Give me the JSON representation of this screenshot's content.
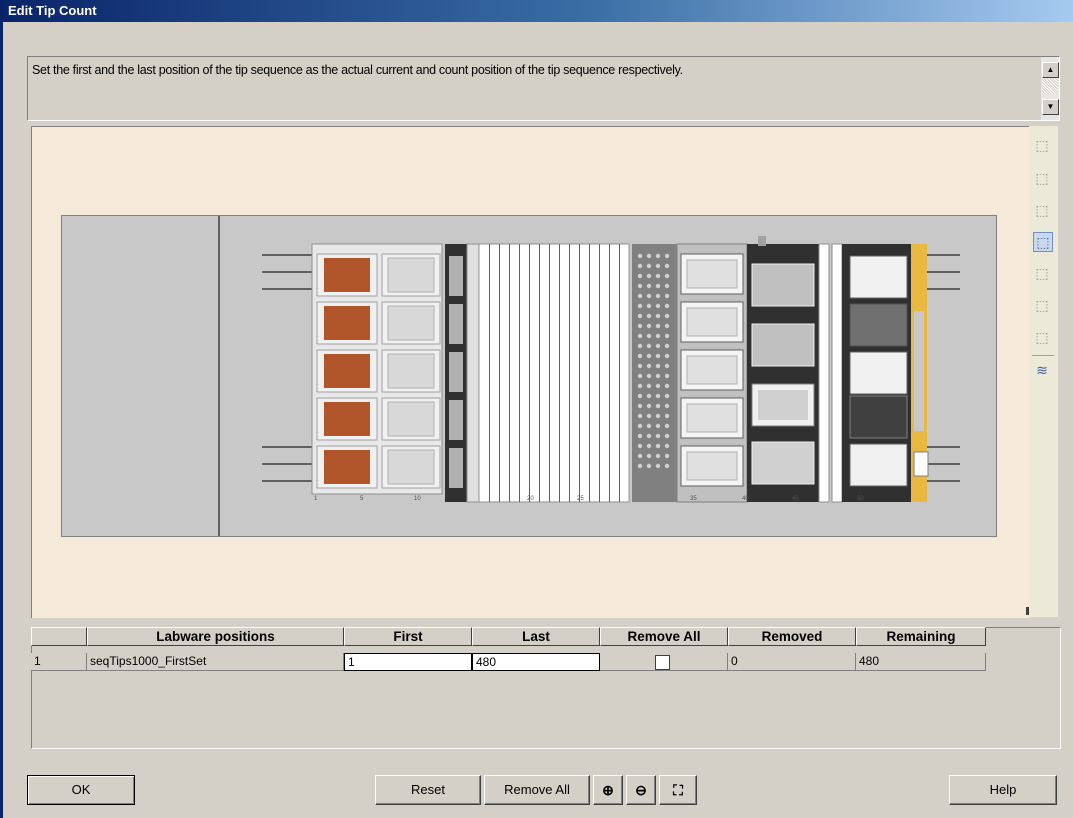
{
  "window": {
    "title": "Edit Tip Count"
  },
  "message": "Set the first and the last position of the tip sequence as the actual  current and count position of the tip sequence respectively.",
  "scroll": {
    "up_icon": "arrow-up",
    "down_icon": "arrow-down"
  },
  "toolbar": {
    "tools": [
      "cube-icon",
      "cube-icon",
      "cube-icon",
      "cube-selected-icon",
      "cube-icon",
      "cube-icon",
      "cube-icon",
      "layers-icon"
    ]
  },
  "deck": {
    "track_labels": [
      "1",
      "5",
      "10",
      "20",
      "25",
      "35",
      "40",
      "45",
      "50"
    ],
    "colors": {
      "tips_orange": "#b0562a",
      "tray_gray": "#dcdcdc",
      "dark": "#303030",
      "accent_yellow": "#e8b840"
    }
  },
  "table": {
    "headers": [
      "Labware positions",
      "First",
      "Last",
      "Remove All",
      "Removed",
      "Remaining"
    ],
    "rows": [
      {
        "index": "1",
        "labware": "seqTips1000_FirstSet",
        "first": "1",
        "last": "480",
        "remove_all": false,
        "removed": "0",
        "remaining": "480"
      }
    ]
  },
  "buttons": {
    "ok": "OK",
    "reset": "Reset",
    "remove_all": "Remove All",
    "zoom_in": "⊕",
    "zoom_out": "⊖",
    "zoom_fit": "⛶",
    "help": "Help"
  }
}
